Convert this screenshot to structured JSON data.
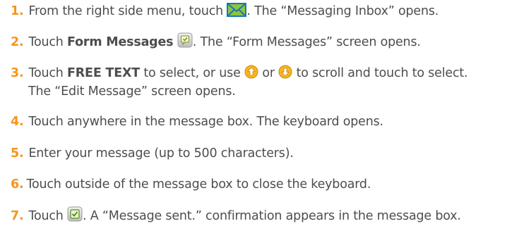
{
  "steps": [
    {
      "number": "1.",
      "text_before": "From the right side menu, touch ",
      "icon": "envelope-icon",
      "text_after": ". The “Messaging Inbox” opens."
    },
    {
      "number": "2.",
      "text_before": "Touch ",
      "bold": "Form Messages",
      "text_middle": " ",
      "icon": "form-message-icon",
      "text_after": ". The “Form Messages” screen opens."
    },
    {
      "number": "3.",
      "text_before": "Touch ",
      "bold": "FREE TEXT",
      "text_middle": " to select, or use ",
      "icon_up": "up-arrow-icon",
      "text_or": " or ",
      "icon_down": "down-arrow-icon",
      "text_after": " to scroll and touch to select.",
      "continuation": "The “Edit Message” screen opens."
    },
    {
      "number": "4.",
      "text": "Touch anywhere in the message box. The keyboard opens."
    },
    {
      "number": "5.",
      "text": "Enter your message (up to 500 characters)."
    },
    {
      "number": "6.",
      "text": "Touch outside of the message box to close the keyboard."
    },
    {
      "number": "7.",
      "text_before": "Touch ",
      "icon": "send-message-icon",
      "text_after": ". A “Message sent.” confirmation appears in the message box."
    }
  ],
  "colors": {
    "text": "#4d4d4f",
    "number": "#f7941d",
    "envelope_fill": "#8cc63f",
    "envelope_stroke": "#1b75bc",
    "arrow_fill": "#f7b521"
  }
}
